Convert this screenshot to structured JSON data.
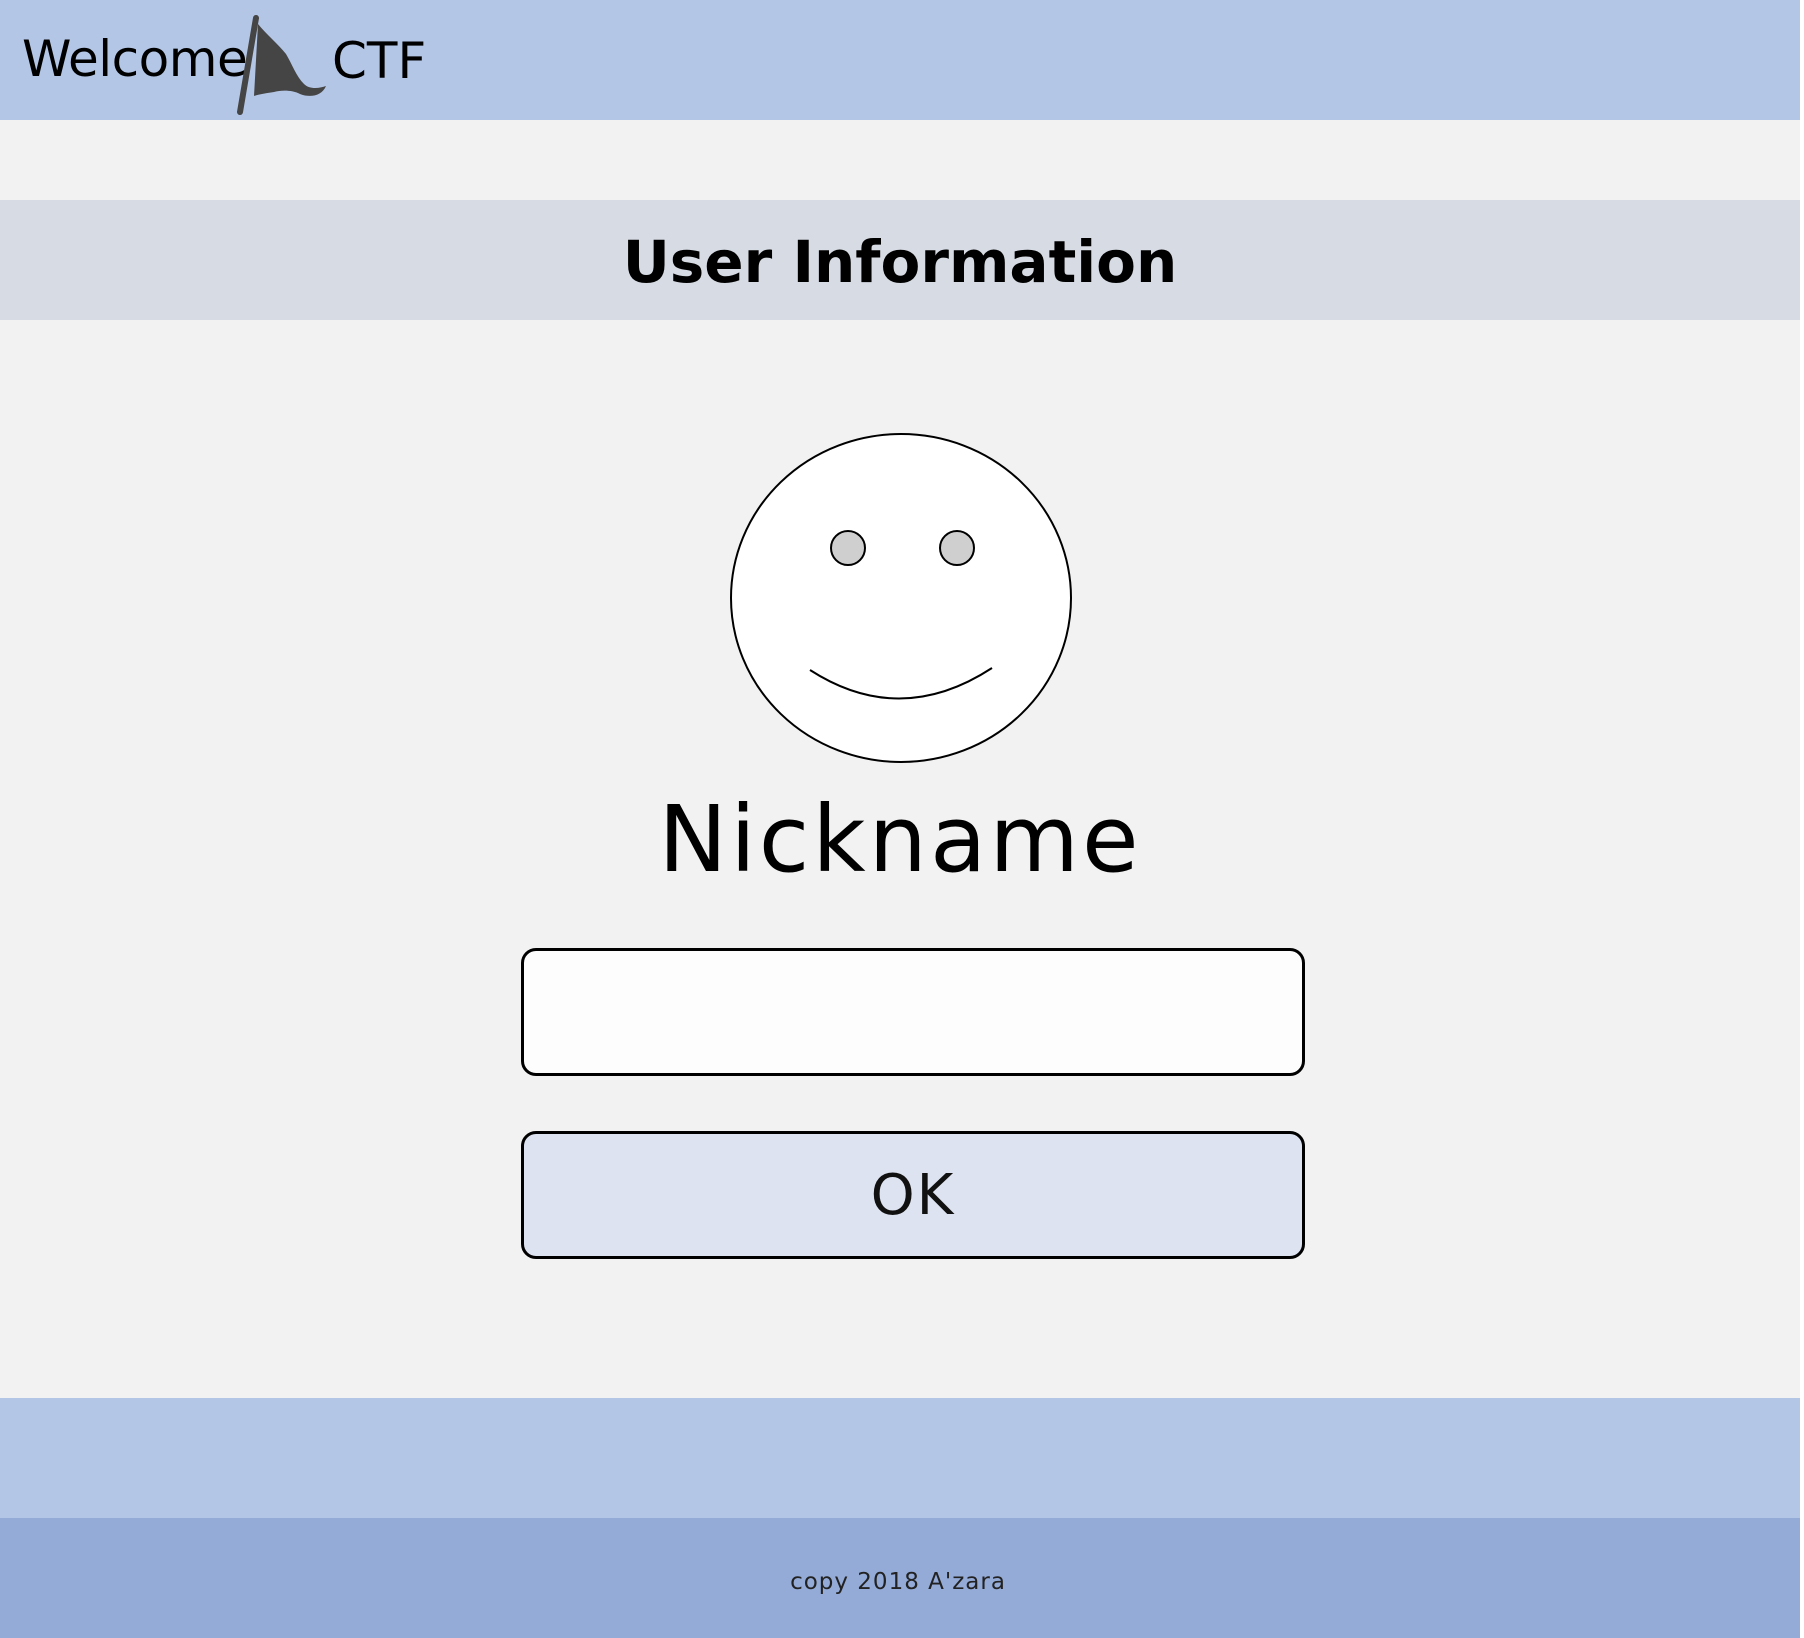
{
  "header": {
    "welcome": "Welcome",
    "ctf": "CTF",
    "logo_icon": "flag-icon"
  },
  "section": {
    "title": "User Information"
  },
  "avatar": {
    "icon": "smiley-face-icon"
  },
  "form": {
    "nickname_label": "Nickname",
    "nickname_value": "",
    "ok_label": "OK"
  },
  "footer": {
    "copyright": "copy 2018 A'zara"
  },
  "colors": {
    "header_bg": "#b4c6e6",
    "section_bar_bg": "#d7dce4",
    "page_bg": "#f2f2f2",
    "button_bg": "#dde3f0",
    "footer_bg": "#94abd8"
  }
}
